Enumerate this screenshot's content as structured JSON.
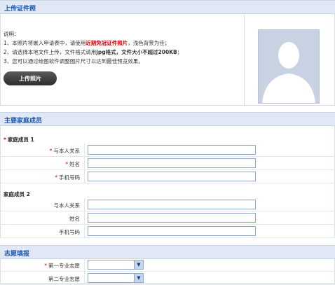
{
  "upload": {
    "header": "上传证件照",
    "note_title": "说明：",
    "line1_a": "1、本照片将嵌入申请表中，请使用",
    "line1_red": "近期免冠证件照片",
    "line1_b": "，浅色背景为佳；",
    "line2_a": "2、请选择本地文件上传，文件格式请用",
    "line2_bold": "jpg格式，文件大小不超过200KB",
    "line2_b": "；",
    "line3": "3、您可以通过绘图软件调整图片尺寸以达到最佳预览效果。",
    "button": "上传照片"
  },
  "family": {
    "header": "主要家庭成员",
    "member1_title": "家庭成员 1",
    "member2_title": "家庭成员 2",
    "labels": {
      "relation": "与本人关系",
      "name": "姓名",
      "phone": "手机号码"
    },
    "required_mark": "*"
  },
  "wish": {
    "header": "志愿填报",
    "first": "第一专业志愿",
    "second": "第二专业志愿"
  },
  "icons": {
    "avatar": "person-silhouette-icon",
    "dropdown": "chevron-down-icon"
  }
}
